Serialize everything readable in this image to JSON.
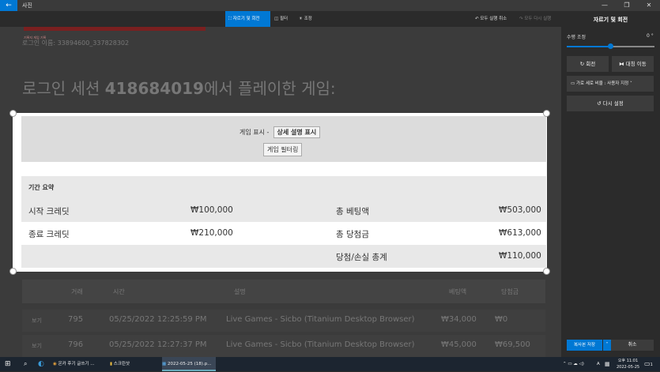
{
  "window": {
    "title": "사진",
    "back": "←",
    "min": "—",
    "max": "❐",
    "close": "✕"
  },
  "toolbar": {
    "crop_label": "자르기 및 회전",
    "filter_label": "필터",
    "adjust_label": "조정",
    "undo_all_label": "모두 실행 취소",
    "redo_all_label": "모두 다시 실행"
  },
  "page": {
    "banner_text": "기록지 게임 기록",
    "login_name": "로그인 이름: 33894600_337828302",
    "session_title_prefix": "로그인 세션 ",
    "session_id": "418684019",
    "session_title_suffix": "에서 플레이한 게임:",
    "view_label": "게임 표시 -",
    "detail_button": "상세 설명 표시",
    "filter_button": "게임 필터링",
    "period_summary": "기간 요약",
    "summary": [
      {
        "label1": "시작 크레딧",
        "value1": "₩100,000",
        "label2": "총 베팅액",
        "value2": "₩503,000"
      },
      {
        "label1": "종료 크레딧",
        "value1": "₩210,000",
        "label2": "총 당첨금",
        "value2": "₩613,000"
      },
      {
        "label1": "",
        "value1": "",
        "label2": "당첨/손실 총계",
        "value2": "₩110,000"
      }
    ],
    "table_headers": [
      "거래",
      "시간",
      "설명",
      "베팅액",
      "당첨금"
    ],
    "table_rows": [
      {
        "action": "보기",
        "id": "795",
        "time": "05/25/2022 12:25:59 PM",
        "desc": "Live Games - Sicbo (Titanium Desktop Browser)",
        "bet": "₩34,000",
        "win": "₩0"
      },
      {
        "action": "보기",
        "id": "796",
        "time": "05/25/2022 12:27:37 PM",
        "desc": "Live Games - Sicbo (Titanium Desktop Browser)",
        "bet": "₩45,000",
        "win": "₩69,500"
      }
    ]
  },
  "panel": {
    "title": "자르기 및 회전",
    "straighten_label": "수평 조정",
    "straighten_value": "0 °",
    "straighten_level": 0.5,
    "rotate_label": "회전",
    "flip_label": "대칭 이동",
    "aspect_label": "가로 세로 비율 : 사용자 지정",
    "reset_label": "다시 설정",
    "save_copy_label": "복사본 저장",
    "cancel_label": "취소"
  },
  "taskbar": {
    "chrome_task": "온카 후기 글쓰기 ...",
    "folder_task": "스크린샷",
    "photo_task": "2022-05-25 (18).p...",
    "time": "오후 11:01",
    "date": "2022-05-25",
    "lang": "A",
    "notification_count": "1"
  },
  "colors": {
    "accent": "#0078d4",
    "panel": "#2b2b2b"
  }
}
